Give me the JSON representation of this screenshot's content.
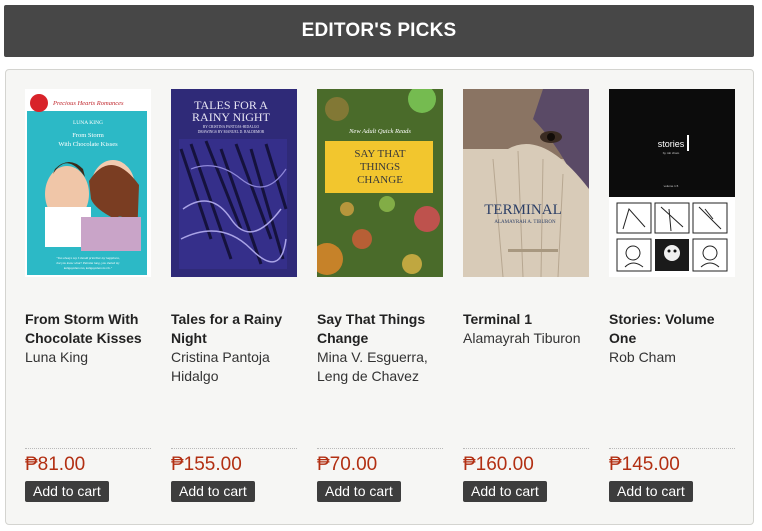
{
  "header": {
    "title": "EDITOR'S PICKS"
  },
  "add_to_cart_label": "Add to cart",
  "books": [
    {
      "title": "From Storm With Chocolate Kisses",
      "author": "Luna King",
      "price": "₱81.00",
      "cover": {
        "series": "Precious Hearts Romances",
        "author": "LUNA KING",
        "title_lines": [
          "From Storm",
          "With Chocolate Kisses"
        ],
        "blurb": "\"Too always say I should prioritize my happiness, but you know what? Pairaba lang, you shaled my kaligayahan mo, kaligayahan ko rin.\"",
        "bg_color": "#2cb9c6"
      }
    },
    {
      "title": "Tales for a Rainy Night",
      "author": "Cristina Pantoja Hidalgo",
      "price": "₱155.00",
      "cover": {
        "title_lines": [
          "TALES FOR A",
          "RAINY NIGHT"
        ],
        "byline": "BY CRISTINA PANTOJA-HIDALGO",
        "illustrator": "DRAWINGS BY MANUEL D. BALDEMOR",
        "bg_color": "#2f2a78"
      }
    },
    {
      "title": "Say That Things Change",
      "author": "Mina V. Esguerra, Leng de Chavez",
      "price": "₱70.00",
      "cover": {
        "tagline": "New Adult Quick Reads",
        "title_lines": [
          "SAY THAT",
          "THINGS",
          "CHANGE"
        ],
        "bg_color": "#4a6b2a"
      }
    },
    {
      "title": "Terminal 1",
      "author": "Alamayrah Tiburon",
      "price": "₱160.00",
      "cover": {
        "title_lines": [
          "TERMINAL"
        ],
        "author": "ALAMAYRAH A. TIBURON",
        "bg_color": "#c9b9a3"
      }
    },
    {
      "title": "Stories: Volume One",
      "author": "Rob Cham",
      "price": "₱145.00",
      "cover": {
        "title_lines": [
          "stories"
        ],
        "byline": "by rob cham",
        "volume": "volume 1.5",
        "bg_color": "#0c0c0c"
      }
    }
  ]
}
